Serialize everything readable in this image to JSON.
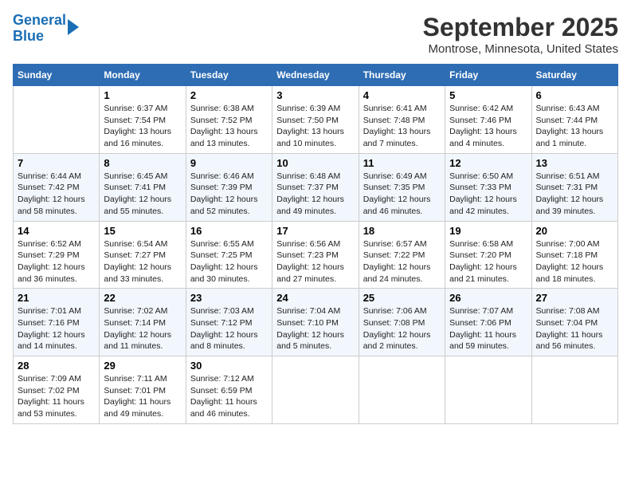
{
  "logo": {
    "line1": "General",
    "line2": "Blue"
  },
  "title": "September 2025",
  "subtitle": "Montrose, Minnesota, United States",
  "days_of_week": [
    "Sunday",
    "Monday",
    "Tuesday",
    "Wednesday",
    "Thursday",
    "Friday",
    "Saturday"
  ],
  "weeks": [
    [
      {
        "num": "",
        "info": ""
      },
      {
        "num": "1",
        "info": "Sunrise: 6:37 AM\nSunset: 7:54 PM\nDaylight: 13 hours and 16 minutes."
      },
      {
        "num": "2",
        "info": "Sunrise: 6:38 AM\nSunset: 7:52 PM\nDaylight: 13 hours and 13 minutes."
      },
      {
        "num": "3",
        "info": "Sunrise: 6:39 AM\nSunset: 7:50 PM\nDaylight: 13 hours and 10 minutes."
      },
      {
        "num": "4",
        "info": "Sunrise: 6:41 AM\nSunset: 7:48 PM\nDaylight: 13 hours and 7 minutes."
      },
      {
        "num": "5",
        "info": "Sunrise: 6:42 AM\nSunset: 7:46 PM\nDaylight: 13 hours and 4 minutes."
      },
      {
        "num": "6",
        "info": "Sunrise: 6:43 AM\nSunset: 7:44 PM\nDaylight: 13 hours and 1 minute."
      }
    ],
    [
      {
        "num": "7",
        "info": "Sunrise: 6:44 AM\nSunset: 7:42 PM\nDaylight: 12 hours and 58 minutes."
      },
      {
        "num": "8",
        "info": "Sunrise: 6:45 AM\nSunset: 7:41 PM\nDaylight: 12 hours and 55 minutes."
      },
      {
        "num": "9",
        "info": "Sunrise: 6:46 AM\nSunset: 7:39 PM\nDaylight: 12 hours and 52 minutes."
      },
      {
        "num": "10",
        "info": "Sunrise: 6:48 AM\nSunset: 7:37 PM\nDaylight: 12 hours and 49 minutes."
      },
      {
        "num": "11",
        "info": "Sunrise: 6:49 AM\nSunset: 7:35 PM\nDaylight: 12 hours and 46 minutes."
      },
      {
        "num": "12",
        "info": "Sunrise: 6:50 AM\nSunset: 7:33 PM\nDaylight: 12 hours and 42 minutes."
      },
      {
        "num": "13",
        "info": "Sunrise: 6:51 AM\nSunset: 7:31 PM\nDaylight: 12 hours and 39 minutes."
      }
    ],
    [
      {
        "num": "14",
        "info": "Sunrise: 6:52 AM\nSunset: 7:29 PM\nDaylight: 12 hours and 36 minutes."
      },
      {
        "num": "15",
        "info": "Sunrise: 6:54 AM\nSunset: 7:27 PM\nDaylight: 12 hours and 33 minutes."
      },
      {
        "num": "16",
        "info": "Sunrise: 6:55 AM\nSunset: 7:25 PM\nDaylight: 12 hours and 30 minutes."
      },
      {
        "num": "17",
        "info": "Sunrise: 6:56 AM\nSunset: 7:23 PM\nDaylight: 12 hours and 27 minutes."
      },
      {
        "num": "18",
        "info": "Sunrise: 6:57 AM\nSunset: 7:22 PM\nDaylight: 12 hours and 24 minutes."
      },
      {
        "num": "19",
        "info": "Sunrise: 6:58 AM\nSunset: 7:20 PM\nDaylight: 12 hours and 21 minutes."
      },
      {
        "num": "20",
        "info": "Sunrise: 7:00 AM\nSunset: 7:18 PM\nDaylight: 12 hours and 18 minutes."
      }
    ],
    [
      {
        "num": "21",
        "info": "Sunrise: 7:01 AM\nSunset: 7:16 PM\nDaylight: 12 hours and 14 minutes."
      },
      {
        "num": "22",
        "info": "Sunrise: 7:02 AM\nSunset: 7:14 PM\nDaylight: 12 hours and 11 minutes."
      },
      {
        "num": "23",
        "info": "Sunrise: 7:03 AM\nSunset: 7:12 PM\nDaylight: 12 hours and 8 minutes."
      },
      {
        "num": "24",
        "info": "Sunrise: 7:04 AM\nSunset: 7:10 PM\nDaylight: 12 hours and 5 minutes."
      },
      {
        "num": "25",
        "info": "Sunrise: 7:06 AM\nSunset: 7:08 PM\nDaylight: 12 hours and 2 minutes."
      },
      {
        "num": "26",
        "info": "Sunrise: 7:07 AM\nSunset: 7:06 PM\nDaylight: 11 hours and 59 minutes."
      },
      {
        "num": "27",
        "info": "Sunrise: 7:08 AM\nSunset: 7:04 PM\nDaylight: 11 hours and 56 minutes."
      }
    ],
    [
      {
        "num": "28",
        "info": "Sunrise: 7:09 AM\nSunset: 7:02 PM\nDaylight: 11 hours and 53 minutes."
      },
      {
        "num": "29",
        "info": "Sunrise: 7:11 AM\nSunset: 7:01 PM\nDaylight: 11 hours and 49 minutes."
      },
      {
        "num": "30",
        "info": "Sunrise: 7:12 AM\nSunset: 6:59 PM\nDaylight: 11 hours and 46 minutes."
      },
      {
        "num": "",
        "info": ""
      },
      {
        "num": "",
        "info": ""
      },
      {
        "num": "",
        "info": ""
      },
      {
        "num": "",
        "info": ""
      }
    ]
  ]
}
